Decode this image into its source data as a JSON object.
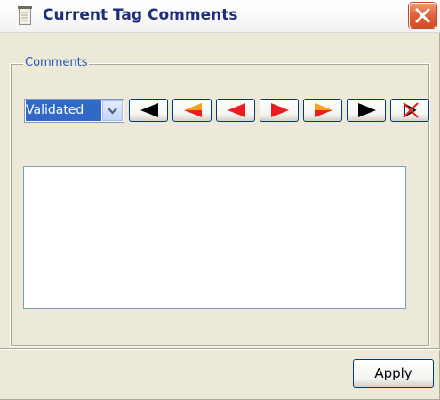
{
  "window": {
    "title": "Current Tag Comments",
    "title_icon": "notepad-icon",
    "close_icon": "close-icon"
  },
  "comments_group": {
    "label": "Comments",
    "status_select": {
      "selected": "Validated"
    },
    "nav_buttons": [
      {
        "name": "first-black-button",
        "icon": "arrow-left-icon",
        "color": "#000000"
      },
      {
        "name": "first-orange-button",
        "icon": "arrow-left-icon",
        "color": "#f7a21b"
      },
      {
        "name": "previous-red-button",
        "icon": "arrow-left-icon",
        "color": "#ec1c24"
      },
      {
        "name": "next-red-button",
        "icon": "arrow-right-icon",
        "color": "#ec1c24"
      },
      {
        "name": "next-orange-button",
        "icon": "arrow-right-icon",
        "color": "#f7a21b"
      },
      {
        "name": "last-black-button",
        "icon": "arrow-right-icon",
        "color": "#000000"
      },
      {
        "name": "delete-button",
        "icon": "delete-x-icon",
        "color": "#ec1c24"
      }
    ],
    "comment_text": ""
  },
  "footer": {
    "apply_label": "Apply"
  }
}
